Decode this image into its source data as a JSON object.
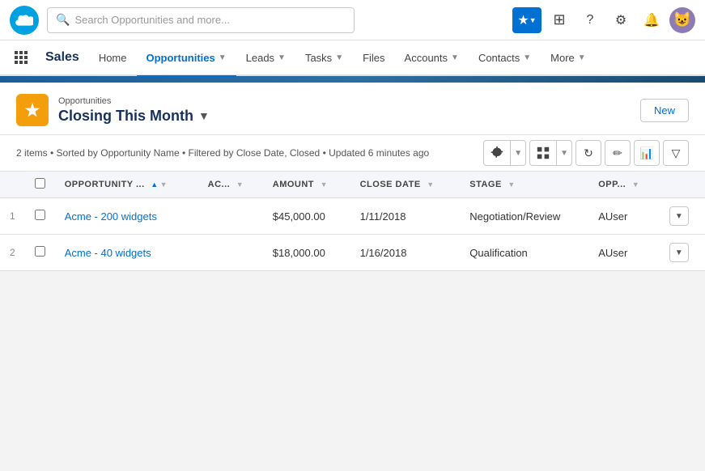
{
  "app": {
    "name": "Sales"
  },
  "search": {
    "placeholder": "Search Opportunities and more..."
  },
  "nav": {
    "items": [
      {
        "label": "Home",
        "active": false,
        "hasDropdown": false
      },
      {
        "label": "Opportunities",
        "active": true,
        "hasDropdown": true
      },
      {
        "label": "Leads",
        "active": false,
        "hasDropdown": true
      },
      {
        "label": "Tasks",
        "active": false,
        "hasDropdown": true
      },
      {
        "label": "Files",
        "active": false,
        "hasDropdown": false
      },
      {
        "label": "Accounts",
        "active": false,
        "hasDropdown": true
      },
      {
        "label": "Contacts",
        "active": false,
        "hasDropdown": true
      },
      {
        "label": "More",
        "active": false,
        "hasDropdown": true
      }
    ]
  },
  "list": {
    "breadcrumb": "Opportunities",
    "title": "Closing This Month",
    "info": "2 items • Sorted by Opportunity Name • Filtered by Close Date, Closed • Updated 6 minutes ago",
    "new_button": "New"
  },
  "table": {
    "columns": [
      {
        "label": "OPPORTUNITY ...",
        "sortable": true,
        "sortDir": "asc"
      },
      {
        "label": "AC...",
        "sortable": false
      },
      {
        "label": "AMOUNT",
        "sortable": false
      },
      {
        "label": "CLOSE DATE",
        "sortable": false
      },
      {
        "label": "STAGE",
        "sortable": false
      },
      {
        "label": "OPP...",
        "sortable": false
      }
    ],
    "rows": [
      {
        "num": "1",
        "opportunity": "Acme - 200 widgets",
        "account": "",
        "amount": "$45,000.00",
        "close_date": "1/11/2018",
        "stage": "Negotiation/Review",
        "owner": "AUser"
      },
      {
        "num": "2",
        "opportunity": "Acme - 40 widgets",
        "account": "",
        "amount": "$18,000.00",
        "close_date": "1/16/2018",
        "stage": "Qualification",
        "owner": "AUser"
      }
    ]
  }
}
